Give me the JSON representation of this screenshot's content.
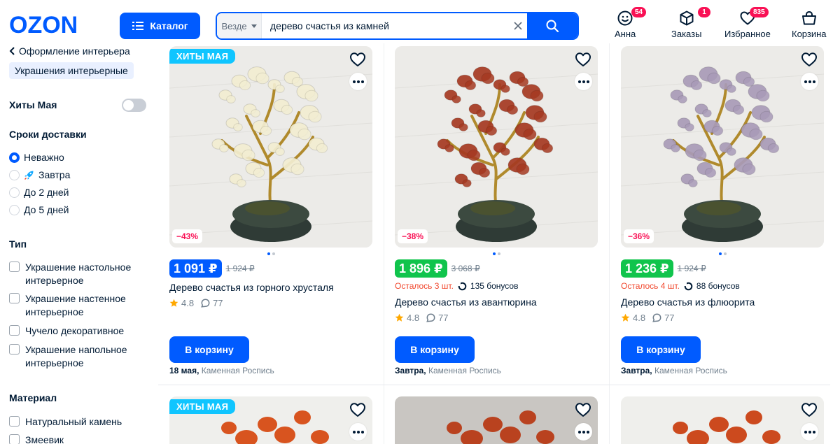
{
  "header": {
    "logo_text": "OZON",
    "catalog_label": "Каталог",
    "search_scope": "Везде",
    "search_value": "дерево счастья из камней",
    "profile": {
      "label": "Анна",
      "badge": "54"
    },
    "orders": {
      "label": "Заказы",
      "badge": "1"
    },
    "favorites": {
      "label": "Избранное",
      "badge": "835"
    },
    "cart": {
      "label": "Корзина"
    }
  },
  "sidebar": {
    "back_label": "Оформление интерьера",
    "current_category": "Украшения интерьерные",
    "hits_label": "Хиты Мая",
    "delivery_title": "Сроки доставки",
    "delivery_options": [
      "Неважно",
      "Завтра",
      "До 2 дней",
      "До 5 дней"
    ],
    "type_title": "Тип",
    "type_options": [
      "Украшение настольное интерьерное",
      "Украшение настенное интерьерное",
      "Чучело декоративное",
      "Украшение напольное интерьерное"
    ],
    "material_title": "Материал",
    "material_options": [
      "Натуральный камень",
      "Змеевик"
    ]
  },
  "products": [
    {
      "promo": "ХИТЫ МАЯ",
      "discount": "−43%",
      "price": "1 091 ₽",
      "old_price": "1 924 ₽",
      "stock": "",
      "bonus": "",
      "title": "Дерево счастья из горного хрусталя",
      "rating": "4.8",
      "reviews": "77",
      "button": "В корзину",
      "delivery_date": "18 мая,",
      "seller": "Каменная Роспись",
      "stone_color": "#f3eed2"
    },
    {
      "promo": "",
      "discount": "−38%",
      "price": "1 896 ₽",
      "old_price": "3 068 ₽",
      "stock": "Осталось 3 шт.",
      "bonus": "135 бонусов",
      "title": "Дерево счастья из авантюрина",
      "rating": "4.8",
      "reviews": "77",
      "button": "В корзину",
      "delivery_date": "Завтра,",
      "seller": "Каменная Роспись",
      "stone_color": "#a63a22"
    },
    {
      "promo": "",
      "discount": "−36%",
      "price": "1 236 ₽",
      "old_price": "1 924 ₽",
      "stock": "Осталось 4 шт.",
      "bonus": "88 бонусов",
      "title": "Дерево счастья из флюорита",
      "rating": "4.8",
      "reviews": "77",
      "button": "В корзину",
      "delivery_date": "Завтра,",
      "seller": "Каменная Роспись",
      "stone_color": "#a99bb8"
    }
  ],
  "next_row": [
    {
      "promo": "ХИТЫ МАЯ",
      "stone_color": "#d8541f"
    },
    {
      "promo": "",
      "stone_color": "#b9421f"
    },
    {
      "promo": "",
      "stone_color": "#cc4a1e"
    }
  ],
  "colors": {
    "brand_blue": "#005bff",
    "price_green": "#10c44c",
    "discount_red": "#f91155",
    "promo_cyan": "#10c5ff"
  }
}
